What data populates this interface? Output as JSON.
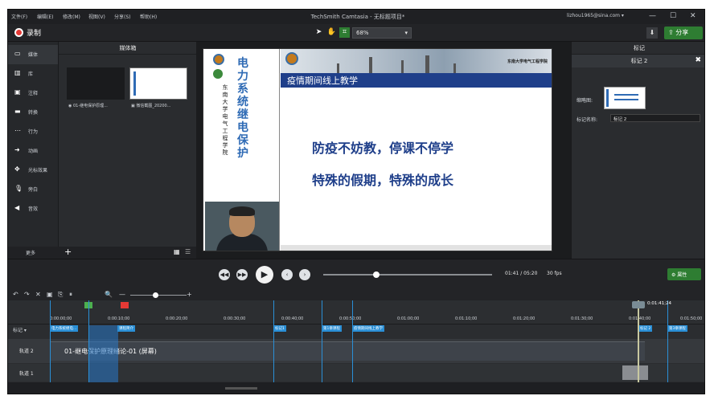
{
  "window": {
    "title": "TechSmith Camtasia - 无标题项目*",
    "account": "lizhou1965@sina.com ▾",
    "menu": [
      "文件(F)",
      "编辑(E)",
      "修改(M)",
      "视图(V)",
      "分享(S)",
      "帮助(H)"
    ],
    "minimize": "—",
    "maximize": "☐",
    "close": "✕"
  },
  "toolbar": {
    "record_label": "录制",
    "zoom": "68%",
    "share_label": "分享",
    "download_icon": "⬇"
  },
  "nav": {
    "items": [
      {
        "label": "媒体",
        "icon": "▭"
      },
      {
        "label": "库",
        "icon": "▥"
      },
      {
        "label": "注释",
        "icon": "▣"
      },
      {
        "label": "转换",
        "icon": "▬"
      },
      {
        "label": "行为",
        "icon": "⋯"
      },
      {
        "label": "动画",
        "icon": "➜"
      },
      {
        "label": "光标效果",
        "icon": "✥"
      },
      {
        "label": "旁白",
        "icon": "🎙"
      },
      {
        "label": "音效",
        "icon": "◀"
      }
    ],
    "more_label": "更多",
    "add_label": "+"
  },
  "media_bin": {
    "title": "媒体箱",
    "items": [
      {
        "label": "◉ 01-继电保护原理..."
      },
      {
        "label": "▣ 微信截图_20200..."
      }
    ]
  },
  "slide": {
    "vertical_title": "电力系统继电保护",
    "vertical_subtitle": "东南大学电气工程学院",
    "banner_label": "东南大学电气工程学院",
    "title": "疫情期间线上教学",
    "line1": "防疫不妨教，停课不停学",
    "line2": "特殊的假期，特殊的成长"
  },
  "properties": {
    "panel_title": "标记",
    "marker_title": "标记 2",
    "close": "✖",
    "thumbnail_label": "缩略图:",
    "name_label": "标记名称:",
    "name_value": "标记 2"
  },
  "player": {
    "timecode": "01:41 / 05:20",
    "fps": "30 fps",
    "properties_button": "属性",
    "prev_icon": "◀◀",
    "next_icon": "▶▶",
    "play_icon": "▶",
    "back_icon": "‹",
    "fwd_icon": "›",
    "progress": 0.316
  },
  "timeline": {
    "tools": [
      "↶",
      "↷",
      "✕",
      "▣",
      "⎘",
      "⏸",
      "🔍",
      "—",
      "+"
    ],
    "playhead_time": "0:01:41;24",
    "marker_row_label": "标记 ▾",
    "ticks": [
      "0:00:00;00",
      "0:00:10;00",
      "0:00:20;00",
      "0:00:30;00",
      "0:00:40;00",
      "0:00:50;00",
      "0:01:00;00",
      "0:01:10;00",
      "0:01:20;00",
      "0:01:30;00",
      "0:01:40;00",
      "0:01:50;00"
    ],
    "track2_label": "轨道 2",
    "track1_label": "轨道 1",
    "clip_label": "01-继电保护原理绪论-01 (屏幕)",
    "markers": [
      {
        "label": "电力系统继电..."
      },
      {
        "label": "课程简介"
      },
      {
        "label": "标记1"
      },
      {
        "label": "第1章课程"
      },
      {
        "label": "疫情期间线上教学"
      },
      {
        "label": "标记 2"
      },
      {
        "label": "第3章课程"
      }
    ]
  }
}
